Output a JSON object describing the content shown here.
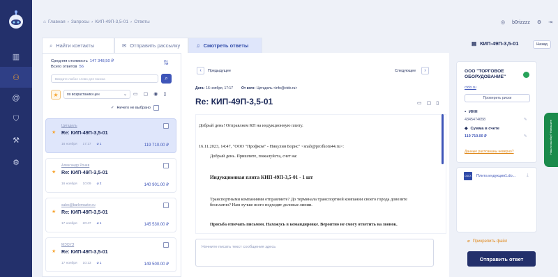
{
  "sidebar": {
    "items": [
      {
        "icon": "chart-icon",
        "glyph": "▥"
      },
      {
        "icon": "users-icon",
        "glyph": "⚇",
        "active": true
      },
      {
        "icon": "at-icon",
        "glyph": "@"
      },
      {
        "icon": "shield-icon",
        "glyph": "⛉"
      },
      {
        "icon": "tools-icon",
        "glyph": "⚒"
      },
      {
        "icon": "gear-icon",
        "glyph": "⚙"
      }
    ]
  },
  "breadcrumb": [
    "Главная",
    "Запросы",
    "КИП-49П-3,5-01",
    "Ответы"
  ],
  "user": {
    "name": "b0rizzzz"
  },
  "tabs": [
    {
      "label": "Найти контакты",
      "icon": "search-icon"
    },
    {
      "label": "Отправить рассылку",
      "icon": "mail-icon"
    },
    {
      "label": "Смотреть ответы",
      "icon": "bell-icon",
      "active": true
    }
  ],
  "request": {
    "title": "КИП-49П-3,5-01",
    "back_label": "Назад"
  },
  "list": {
    "avg_cost_label": "Средняя стоимость",
    "avg_cost": "147 348,50 ₽",
    "total_label": "Всего ответов",
    "total": "56",
    "search_placeholder": "Введите любое слово для поиска",
    "sort": "по возрастанию цен",
    "nothing_selected": "Ничего не выбрано",
    "items": [
      {
        "sender": "Цитадель",
        "subject": "Re: КИП-49П-3,5-01",
        "date": "16 ноября",
        "time": "17:17",
        "attachments": "1",
        "price": "119 710.00 ₽"
      },
      {
        "sender": "Александр Рочев",
        "subject": "Re: КИП-49П-3,5-01",
        "date": "16 ноября",
        "time": "10:09",
        "attachments": "2",
        "price": "140 901.00 ₽"
      },
      {
        "sender": "sales@barlemaster.ru",
        "subject": "Re: КИП-49П-3,5-01",
        "date": "17 ноября",
        "time": "20:47",
        "attachments": "1",
        "price": "145 530.00 ₽"
      },
      {
        "sender": "МЭОУЭ",
        "subject": "Re: КИП-49П-3,5-01",
        "date": "17 ноября",
        "time": "10:13",
        "attachments": "1",
        "price": "149 500.00 ₽"
      }
    ]
  },
  "mail": {
    "prev_label": "Предыдущее",
    "next_label": "Следующее",
    "date_label": "Дата:",
    "date": "16 ноября, 17:17",
    "from_label": "От кого:",
    "from": "Цитадель <info@ctdo.ru>",
    "title": "Re: КИП-49П-3,5-01",
    "body": {
      "greeting": "Добрый день! Отправляем КП на индукционную плиту.",
      "quote_header": "16.11.2023, 14:47, \"ООО \"Профком\" - Никулин Борис\" <snab@profkom44.ru>:",
      "quote_greeting": "Добрый день. Пришлите, пожалуйста, счет на:",
      "product": "Индукционная плита КИП-49П-3,5-01 - 1 шт",
      "transport_1": "Транспортными компаниями отправляете? До терминала транспортной компании своего города довозите",
      "transport_2": "бесплатно? Нам лучше всего подходят деловые линии.",
      "note": "Просьба отвечать письмом. Нахожусь в командировке. Вероятно не смогу ответить на звонок."
    },
    "composer_placeholder": "Начните писать текст сообщения здесь"
  },
  "supplier": {
    "name": "ООО \"ТОРГОВОЕ ОБОРУДОВАНИЕ\"",
    "site": "ctdo.ru",
    "check_label": "Проверить риски",
    "inn_label": "ИНН",
    "inn": "4345474658",
    "sum_label": "Сумма в счете",
    "sum": "119 710.00 ₽",
    "wrong_data": "Данные распознаны неверно?"
  },
  "attachment": {
    "type": "DOCX",
    "name": "Плита индукция1.do..."
  },
  "actions": {
    "attach_label": "Прикрепить файл",
    "send_label": "Отправить ответ"
  },
  "side_tab": {
    "label": "Нашли ошибку? Напишите"
  },
  "colors": {
    "sidebar": "#23306b",
    "accent": "#3e55b8",
    "orange": "#f7a531",
    "green": "#1a8a4b"
  }
}
